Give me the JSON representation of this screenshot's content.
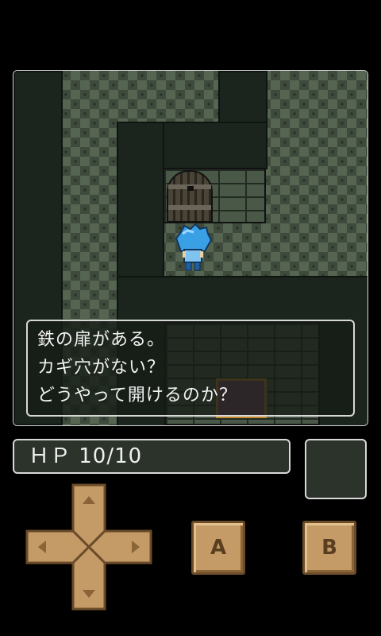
{
  "message": {
    "lines": [
      "鉄の扉がある。",
      "カギ穴がない？",
      "どうやって開けるのか？"
    ]
  },
  "status": {
    "hp_text": "ＨＰ 10/10"
  },
  "controls": {
    "a_label": "A",
    "b_label": "B",
    "dpad_icons": [
      "arrow-up-icon",
      "arrow-left-icon",
      "arrow-right-icon",
      "arrow-down-icon"
    ]
  },
  "colors": {
    "button": "#c49a66",
    "frame": "#d8d8d8",
    "floor": "#3e4a3c",
    "hero": "#3aa0e6"
  }
}
